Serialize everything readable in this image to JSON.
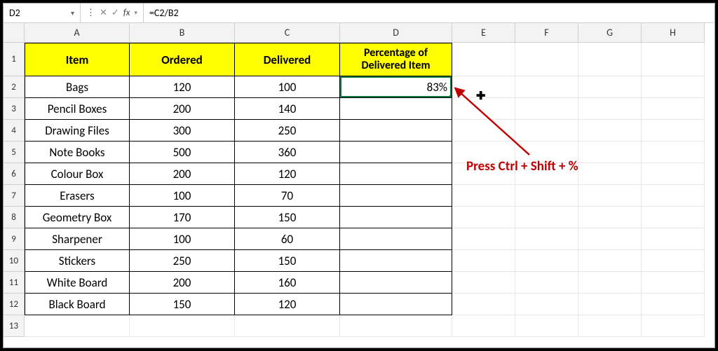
{
  "formula_bar": {
    "name_box": "D2",
    "fx_label": "fx",
    "formula": "=C2/B2"
  },
  "columns": [
    "A",
    "B",
    "C",
    "D",
    "E",
    "F",
    "G",
    "H"
  ],
  "row_numbers": [
    "1",
    "2",
    "3",
    "4",
    "5",
    "6",
    "7",
    "8",
    "9",
    "10",
    "11",
    "12",
    "13"
  ],
  "headers": {
    "item": "Item",
    "ordered": "Ordered",
    "delivered": "Delivered",
    "percentage": "Percentage of Delivered Item"
  },
  "data_rows": [
    {
      "item": "Bags",
      "ordered": "120",
      "delivered": "100",
      "percentage": "83%"
    },
    {
      "item": "Pencil Boxes",
      "ordered": "200",
      "delivered": "140",
      "percentage": ""
    },
    {
      "item": "Drawing Files",
      "ordered": "300",
      "delivered": "250",
      "percentage": ""
    },
    {
      "item": "Note Books",
      "ordered": "500",
      "delivered": "360",
      "percentage": ""
    },
    {
      "item": "Colour Box",
      "ordered": "200",
      "delivered": "120",
      "percentage": ""
    },
    {
      "item": "Erasers",
      "ordered": "100",
      "delivered": "70",
      "percentage": ""
    },
    {
      "item": "Geometry Box",
      "ordered": "170",
      "delivered": "150",
      "percentage": ""
    },
    {
      "item": "Sharpener",
      "ordered": "100",
      "delivered": "60",
      "percentage": ""
    },
    {
      "item": "Stickers",
      "ordered": "250",
      "delivered": "150",
      "percentage": ""
    },
    {
      "item": "White Board",
      "ordered": "200",
      "delivered": "160",
      "percentage": ""
    },
    {
      "item": "Black Board",
      "ordered": "150",
      "delivered": "120",
      "percentage": ""
    }
  ],
  "annotation": {
    "text": "Press Ctrl + Shift + %"
  },
  "chart_data": {
    "type": "table",
    "columns": [
      "Item",
      "Ordered",
      "Delivered",
      "Percentage of Delivered Item"
    ],
    "rows": [
      [
        "Bags",
        120,
        100,
        "83%"
      ],
      [
        "Pencil Boxes",
        200,
        140,
        ""
      ],
      [
        "Drawing Files",
        300,
        250,
        ""
      ],
      [
        "Note Books",
        500,
        360,
        ""
      ],
      [
        "Colour Box",
        200,
        120,
        ""
      ],
      [
        "Erasers",
        100,
        70,
        ""
      ],
      [
        "Geometry Box",
        170,
        150,
        ""
      ],
      [
        "Sharpener",
        100,
        60,
        ""
      ],
      [
        "Stickers",
        250,
        150,
        ""
      ],
      [
        "White Board",
        200,
        160,
        ""
      ],
      [
        "Black Board",
        150,
        120,
        ""
      ]
    ]
  }
}
